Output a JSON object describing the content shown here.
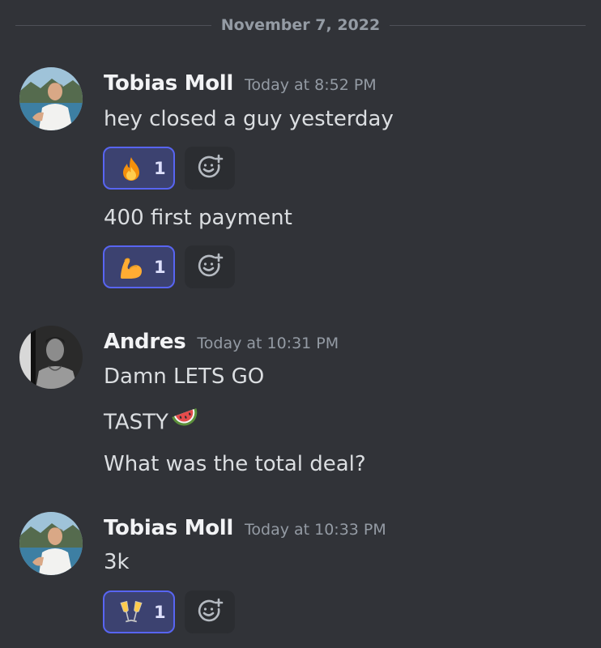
{
  "date_divider": "November 7, 2022",
  "messages": [
    {
      "author": "Tobias Moll",
      "time": "Today at 8:52 PM",
      "lines": [
        "hey closed a guy yesterday",
        "400 first payment"
      ],
      "reactions": [
        {
          "emoji": "fire-emoji",
          "count": "1"
        },
        {
          "emoji": "flexed-biceps-emoji",
          "count": "1"
        }
      ]
    },
    {
      "author": "Andres",
      "time": "Today at 10:31 PM",
      "lines": [
        "Damn LETS GO",
        "TASTY",
        "What was the total deal?"
      ],
      "inline_emoji": "watermelon-emoji"
    },
    {
      "author": "Tobias Moll",
      "time": "Today at 10:33 PM",
      "lines": [
        "3k"
      ],
      "reactions": [
        {
          "emoji": "clinking-glasses-emoji",
          "count": "1"
        }
      ]
    }
  ],
  "colors": {
    "background": "#313338",
    "reaction_border": "#5865f2",
    "reaction_fill": "#3c4270",
    "muted_text": "#949ba4"
  }
}
